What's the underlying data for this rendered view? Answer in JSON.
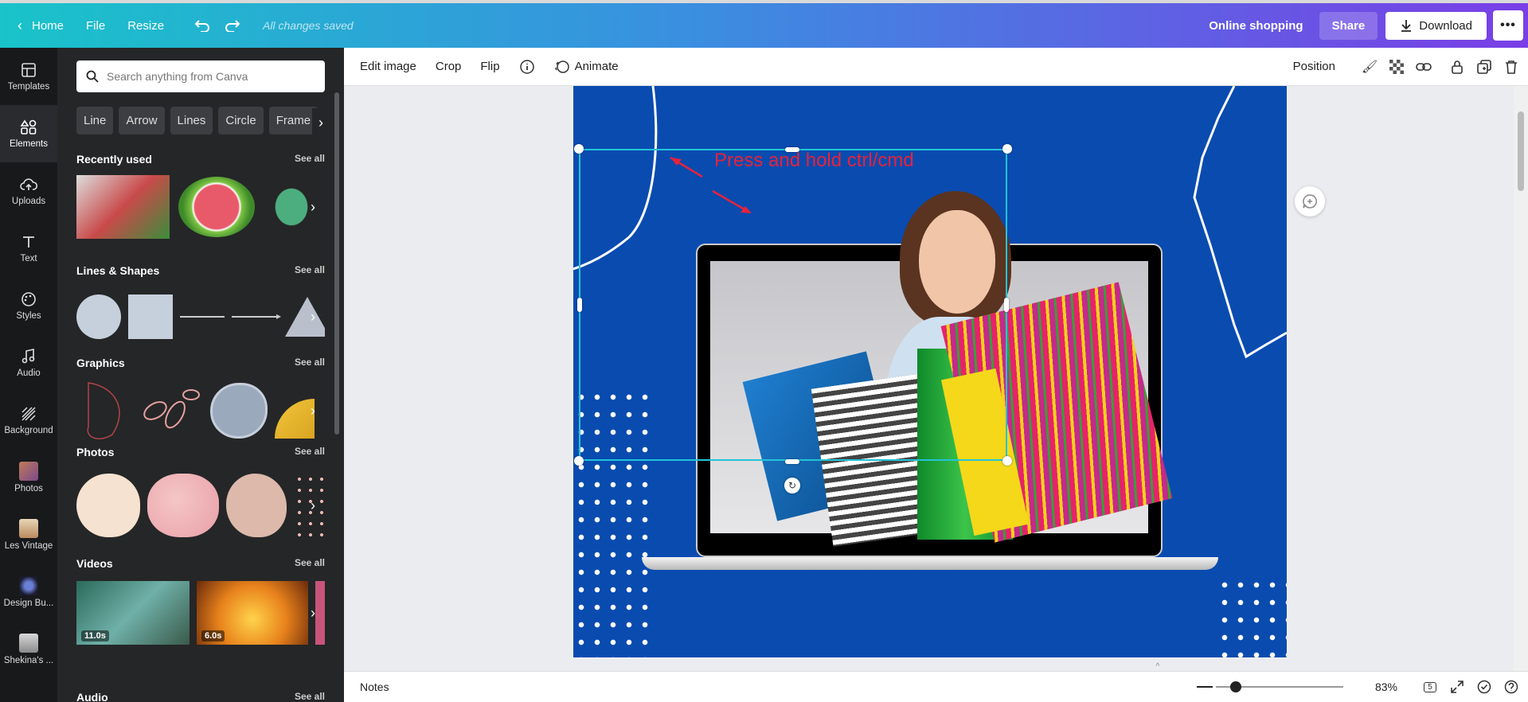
{
  "topbar": {
    "home": "Home",
    "file": "File",
    "resize": "Resize",
    "status": "All changes saved",
    "project_title": "Online shopping",
    "share": "Share",
    "download": "Download"
  },
  "rail": [
    {
      "label": "Templates",
      "icon": "templates-icon"
    },
    {
      "label": "Elements",
      "icon": "elements-icon",
      "active": true
    },
    {
      "label": "Uploads",
      "icon": "uploads-icon"
    },
    {
      "label": "Text",
      "icon": "text-icon"
    },
    {
      "label": "Styles",
      "icon": "styles-icon"
    },
    {
      "label": "Audio",
      "icon": "audio-icon"
    },
    {
      "label": "Background",
      "icon": "background-icon"
    },
    {
      "label": "Photos",
      "icon": "photos-icon"
    },
    {
      "label": "Les Vintage",
      "icon": "les-vintage-icon"
    },
    {
      "label": "Design Bu...",
      "icon": "design-bu-icon"
    },
    {
      "label": "Shekina's ...",
      "icon": "shekinas-icon"
    }
  ],
  "panel": {
    "search_placeholder": "Search anything from Canva",
    "chips": [
      "Line",
      "Arrow",
      "Lines",
      "Circle",
      "Frame"
    ],
    "see_all": "See all",
    "sections": {
      "recent": "Recently used",
      "shapes": "Lines & Shapes",
      "graphics": "Graphics",
      "photos": "Photos",
      "videos": "Videos",
      "audio": "Audio"
    },
    "video_durations": [
      "11.0s",
      "6.0s"
    ]
  },
  "toolbar": {
    "edit_image": "Edit image",
    "crop": "Crop",
    "flip": "Flip",
    "animate": "Animate",
    "position": "Position"
  },
  "canvas": {
    "annotation": "Press and hold ctrl/cmd"
  },
  "bottombar": {
    "notes": "Notes",
    "zoom": "83%",
    "pages": "5"
  },
  "colors": {
    "design_bg": "#0a4bb0",
    "selection": "#22c4d8",
    "annotation": "#e5233b"
  }
}
